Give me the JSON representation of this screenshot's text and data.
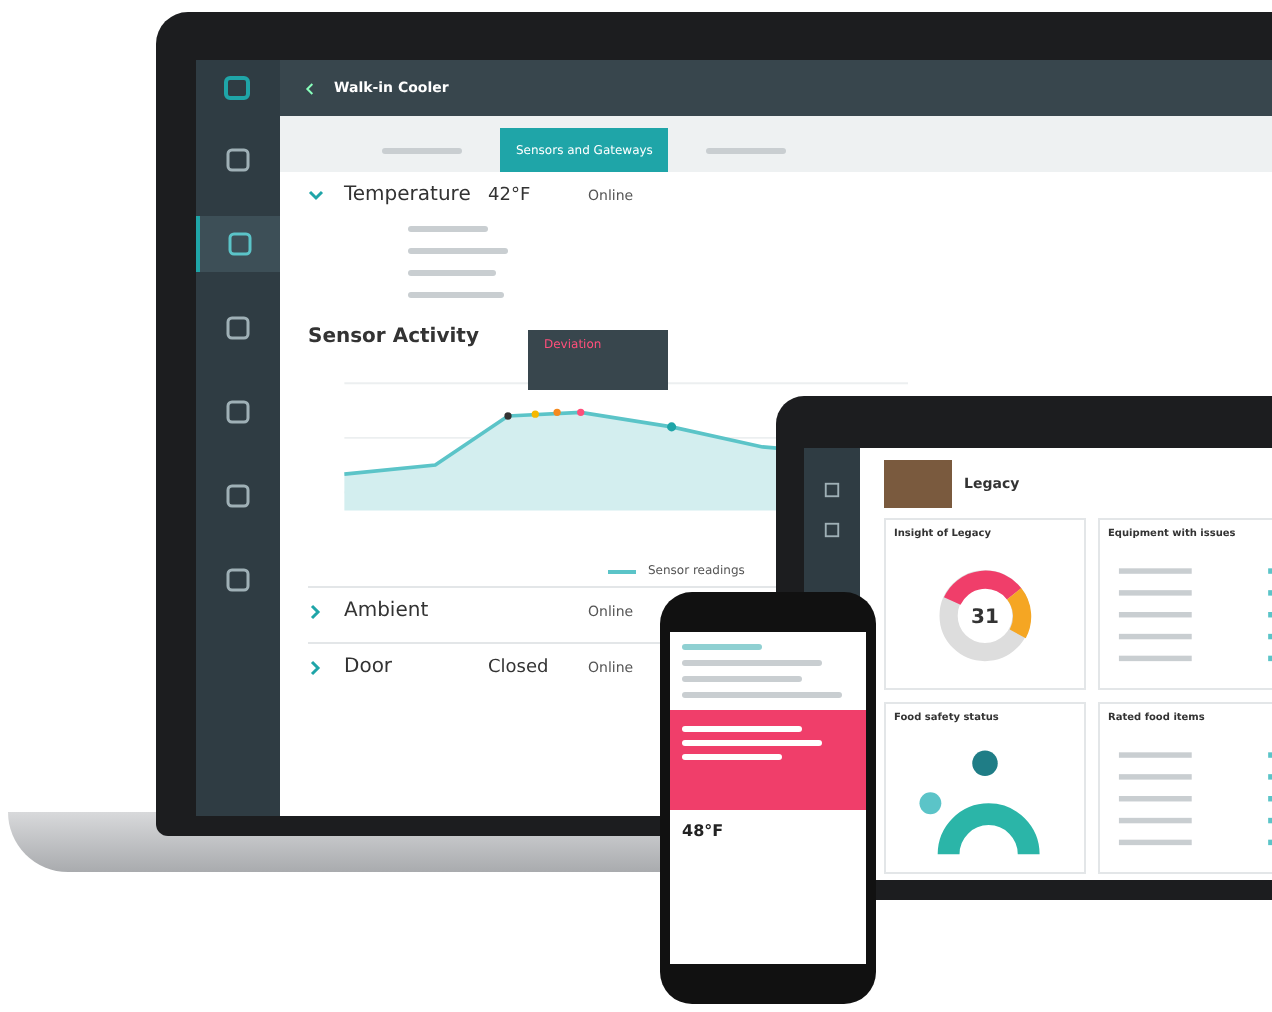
{
  "laptop": {
    "header": {
      "title": "Walk-in Cooler"
    },
    "tabs": [
      {
        "selected": false
      },
      {
        "label": "Sensors and Gateways",
        "selected": true
      },
      {
        "selected": false
      }
    ],
    "sensors": [
      {
        "name": "Temperature",
        "reading": "42°F",
        "status": "Online",
        "expanded": true
      },
      {
        "name": "Ambient",
        "status": "Online",
        "expanded": false
      },
      {
        "name": "Door",
        "reading": "Closed",
        "status": "Online",
        "expanded": false
      }
    ],
    "activity": {
      "title": "Sensor Activity",
      "tooltip": "Deviation",
      "legend": "Sensor readings"
    }
  },
  "tablet": {
    "title": "Legacy",
    "cards": [
      {
        "title": "Insight of Legacy",
        "kind": "donut",
        "center": "31"
      },
      {
        "title": "Equipment with issues",
        "kind": "list"
      },
      {
        "title": "Food safety status",
        "kind": "bubbles"
      },
      {
        "title": "Rated food items",
        "kind": "list"
      }
    ]
  },
  "phone": {
    "temperature": "48°F"
  }
}
